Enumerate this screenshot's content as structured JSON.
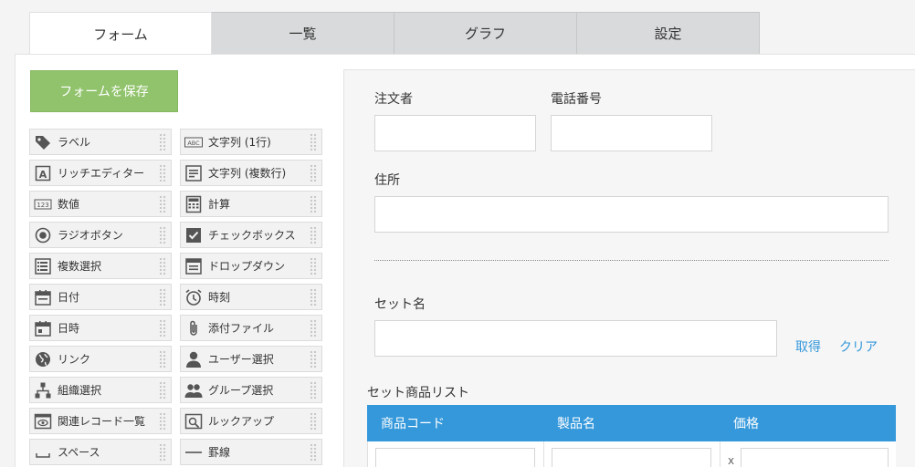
{
  "tabs": [
    {
      "label": "フォーム",
      "active": true
    },
    {
      "label": "一覧",
      "active": false
    },
    {
      "label": "グラフ",
      "active": false
    },
    {
      "label": "設定",
      "active": false
    }
  ],
  "save_button": "フォームを保存",
  "palette": {
    "left": [
      {
        "label": "ラベル",
        "icon": "tag-icon"
      },
      {
        "label": "リッチエディター",
        "icon": "rich-editor-icon"
      },
      {
        "label": "数値",
        "icon": "number-icon"
      },
      {
        "label": "ラジオボタン",
        "icon": "radio-icon"
      },
      {
        "label": "複数選択",
        "icon": "multi-select-icon"
      },
      {
        "label": "日付",
        "icon": "date-icon"
      },
      {
        "label": "日時",
        "icon": "datetime-icon"
      },
      {
        "label": "リンク",
        "icon": "globe-icon"
      },
      {
        "label": "組織選択",
        "icon": "org-icon"
      },
      {
        "label": "関連レコード一覧",
        "icon": "related-records-icon"
      },
      {
        "label": "スペース",
        "icon": "space-icon"
      }
    ],
    "right": [
      {
        "label": "文字列 (1行)",
        "icon": "text-line-icon"
      },
      {
        "label": "文字列 (複数行)",
        "icon": "text-multiline-icon"
      },
      {
        "label": "計算",
        "icon": "calculator-icon"
      },
      {
        "label": "チェックボックス",
        "icon": "checkbox-icon"
      },
      {
        "label": "ドロップダウン",
        "icon": "dropdown-icon"
      },
      {
        "label": "時刻",
        "icon": "clock-icon"
      },
      {
        "label": "添付ファイル",
        "icon": "paperclip-icon"
      },
      {
        "label": "ユーザー選択",
        "icon": "user-icon"
      },
      {
        "label": "グループ選択",
        "icon": "group-icon"
      },
      {
        "label": "ルックアップ",
        "icon": "lookup-icon"
      },
      {
        "label": "罫線",
        "icon": "line-icon"
      }
    ]
  },
  "form": {
    "orderer_label": "注文者",
    "phone_label": "電話番号",
    "address_label": "住所",
    "set_name_label": "セット名",
    "fetch_link": "取得",
    "clear_link": "クリア",
    "table_title": "セット商品リスト",
    "table_headers": [
      "商品コード",
      "製品名",
      "価格"
    ],
    "price_prefix": "x"
  },
  "colors": {
    "accent": "#3498db",
    "save_button": "#91c36c"
  }
}
